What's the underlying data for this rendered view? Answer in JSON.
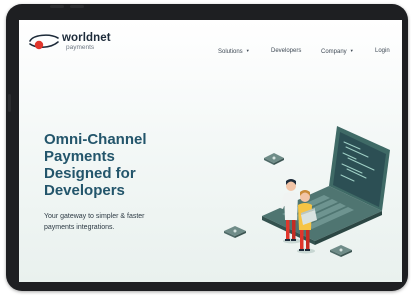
{
  "brand": {
    "name": "worldnet",
    "subtitle": "payments"
  },
  "nav": {
    "items": [
      {
        "label": "Solutions",
        "has_dropdown": true
      },
      {
        "label": "Developers",
        "has_dropdown": false
      },
      {
        "label": "Company",
        "has_dropdown": true
      },
      {
        "label": "Login",
        "has_dropdown": false
      }
    ]
  },
  "hero": {
    "title": "Omni-Channel\nPayments\nDesigned for\nDevelopers",
    "subtitle": "Your gateway to simpler & faster\npayments integrations."
  },
  "colors": {
    "title": "#23556b",
    "accent_red": "#e0362c",
    "laptop": "#3f6a66",
    "laptop_screen": "#2c4f54"
  }
}
